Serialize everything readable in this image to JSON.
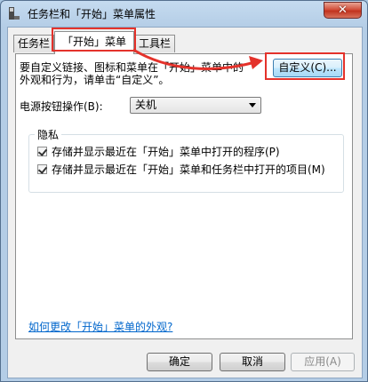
{
  "window": {
    "title": "任务栏和「开始」菜单属性",
    "close_glyph": "✕"
  },
  "tabs": [
    {
      "label": "任务栏",
      "active": false
    },
    {
      "label": "「开始」菜单",
      "active": true
    },
    {
      "label": "工具栏",
      "active": false
    }
  ],
  "start_menu": {
    "description_line1": "要自定义链接、图标和菜单在「开始」菜单中的",
    "description_line2": "外观和行为，请单击“自定义”。",
    "customize_button": "自定义(C)...",
    "power_label": "电源按钮操作(B):",
    "power_value": "关机",
    "privacy_title": "隐私",
    "privacy_items": [
      {
        "label": "存储并显示最近在「开始」菜单中打开的程序(P)",
        "checked": true
      },
      {
        "label": "存储并显示最近在「开始」菜单和任务栏中打开的项目(M)",
        "checked": true
      }
    ],
    "help_link": "如何更改「开始」菜单的外观?"
  },
  "footer": {
    "ok": "确定",
    "cancel": "取消",
    "apply": "应用(A)"
  },
  "colors": {
    "annotation": "#e4322b",
    "link": "#0066cc",
    "close": "#c1321e"
  }
}
